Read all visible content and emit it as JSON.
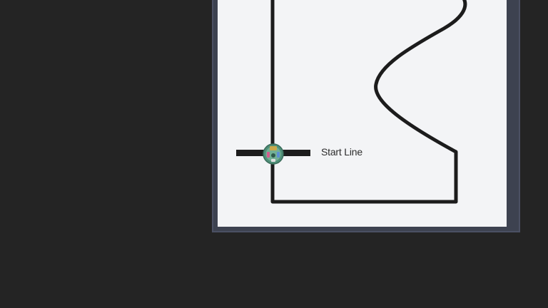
{
  "labels": {
    "start_line": "Start Line"
  },
  "colors": {
    "background": "#242424",
    "board_surface": "#f3f4f6",
    "board_frame": "#3d4250",
    "track_line": "#1c1c1c",
    "robot_body": "#6aa88a"
  },
  "icons": {
    "robot": "line-follower-robot-icon"
  }
}
